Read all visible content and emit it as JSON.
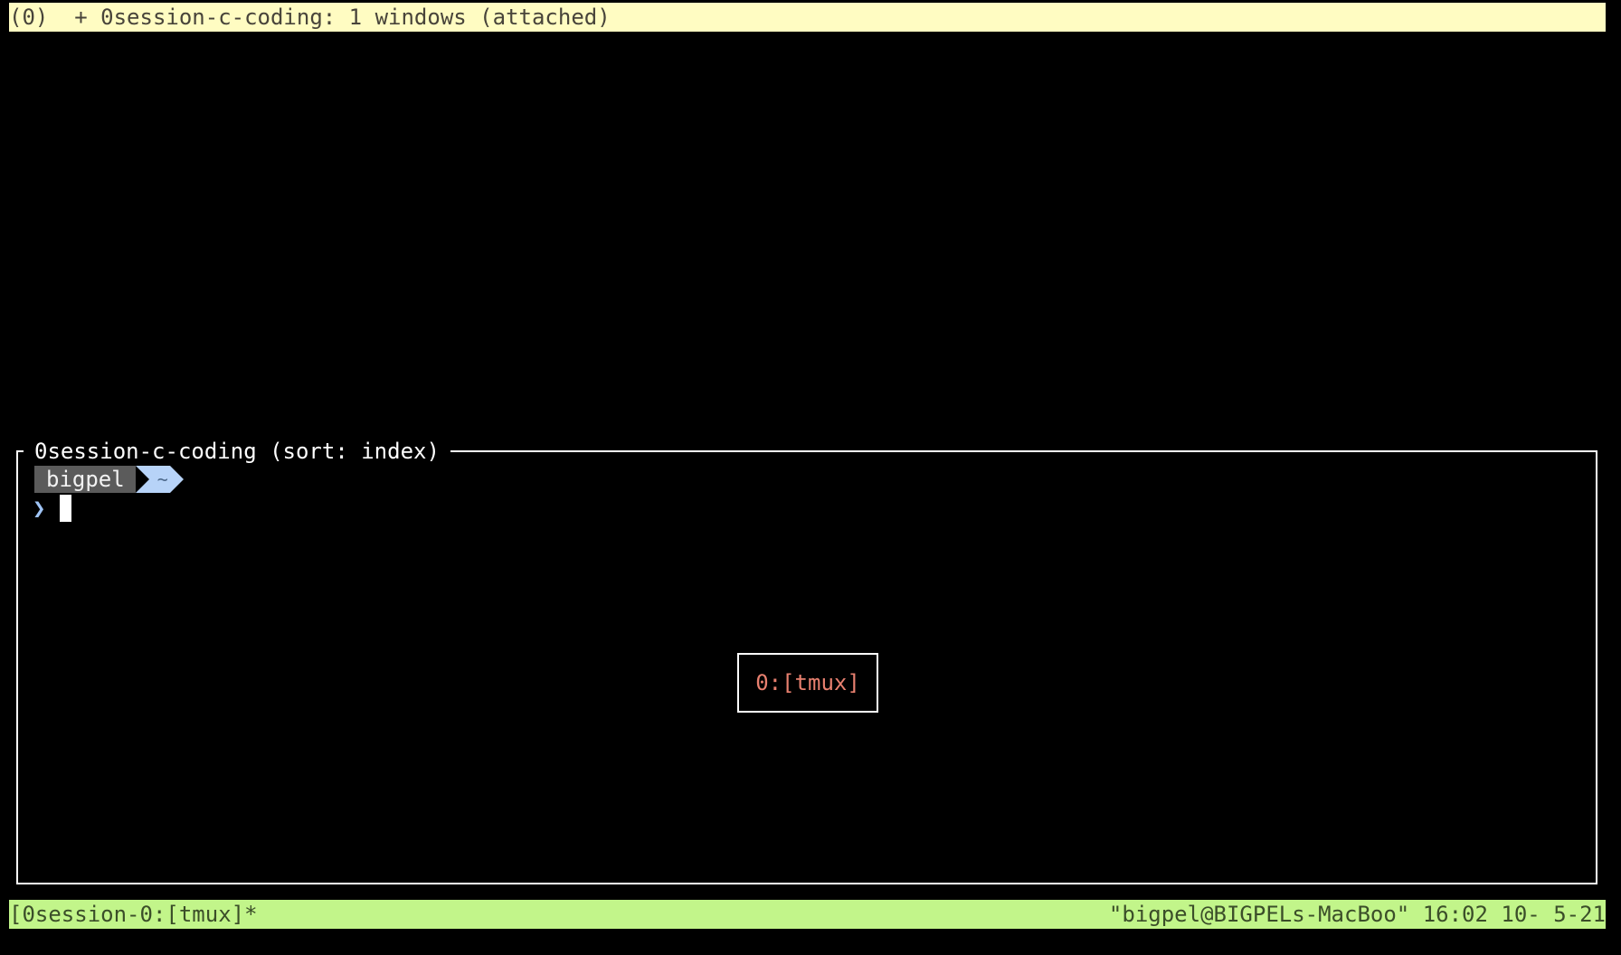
{
  "top_bar": {
    "text": "(0)  + 0session-c-coding: 1 windows (attached)"
  },
  "preview": {
    "title": "0session-c-coding (sort: index)",
    "prompt_user": "bigpel",
    "prompt_dir": "~",
    "prompt_symbol": "❯",
    "window_label": "0:[tmux]"
  },
  "status_bar": {
    "left": "[0session-0:[tmux]*",
    "right": "\"bigpel@BIGPELs-MacBoo\" 16:02 10- 5-21"
  },
  "colors": {
    "top_bar_bg": "#fffcc2",
    "status_bar_bg": "#c2f58a",
    "prompt_user_bg": "#5b5b5b",
    "prompt_dir_bg": "#b7d3f8",
    "window_label_text": "#e8806f"
  }
}
